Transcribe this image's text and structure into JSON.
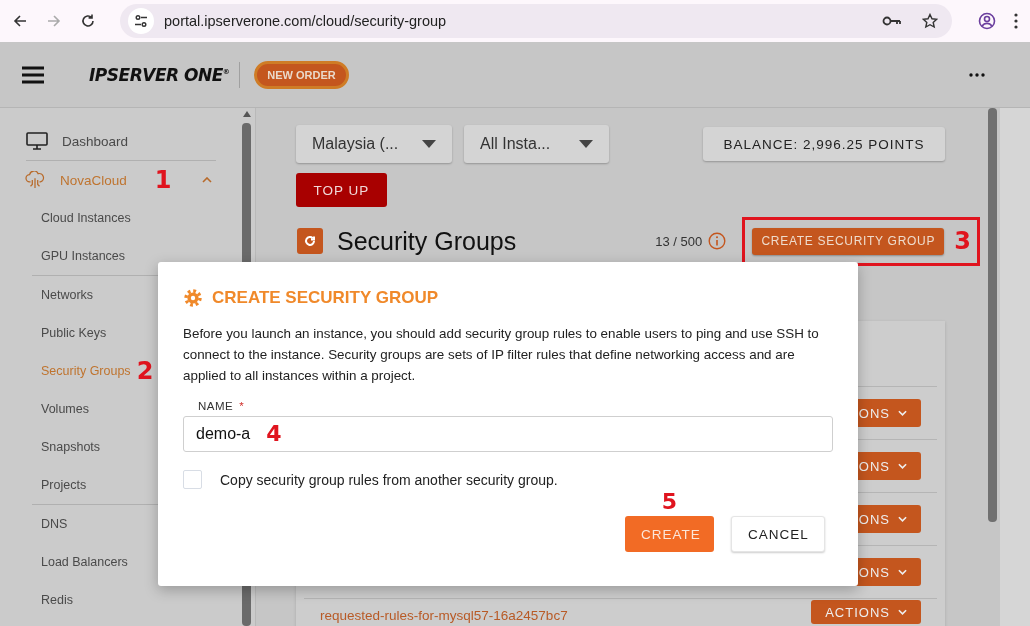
{
  "browser": {
    "url": "portal.ipserverone.com/cloud/security-group"
  },
  "header": {
    "logo": "IPSERVER ONE",
    "logo_mark": "®",
    "new_order": "NEW ORDER"
  },
  "sidebar": {
    "items": [
      {
        "label": "Dashboard",
        "kind": "monitor",
        "selected": false
      },
      {
        "label": "NovaCloud",
        "kind": "cloud",
        "selected": true,
        "expanded": true,
        "step": "1",
        "children": [
          {
            "label": "Cloud Instances",
            "selected": false,
            "divider_before": false
          },
          {
            "label": "GPU Instances",
            "selected": false,
            "divider_before": false
          },
          {
            "label": "Networks",
            "selected": false,
            "divider_before": true
          },
          {
            "label": "Public Keys",
            "selected": false,
            "divider_before": false
          },
          {
            "label": "Security Groups",
            "selected": true,
            "divider_before": false,
            "step": "2"
          },
          {
            "label": "Volumes",
            "selected": false,
            "divider_before": false
          },
          {
            "label": "Snapshots",
            "selected": false,
            "divider_before": false
          },
          {
            "label": "Projects",
            "selected": false,
            "divider_before": false
          },
          {
            "label": "DNS",
            "selected": false,
            "divider_before": true
          },
          {
            "label": "Load Balancers",
            "selected": false,
            "divider_before": false
          },
          {
            "label": "Redis",
            "selected": false,
            "divider_before": false
          }
        ]
      }
    ]
  },
  "filters": [
    {
      "value": "Malaysia (..."
    },
    {
      "value": "All Insta..."
    }
  ],
  "balance": "BALANCE: 2,996.25 POINTS",
  "top_up": "TOP UP",
  "page_title": "Security Groups",
  "count": "13 / 500",
  "create_button": {
    "label": "CREATE SECURITY GROUP",
    "step": "3"
  },
  "rows": [
    {
      "action": "ONS"
    },
    {
      "action": "ONS"
    },
    {
      "action": "ONS"
    },
    {
      "action": "ONS"
    },
    {
      "name": "requested-rules-for-mysql57-16a2457bc7",
      "action": "ACTIONS"
    }
  ],
  "dialog": {
    "title": "CREATE SECURITY GROUP",
    "description": "Before you launch an instance, you should add security group rules to enable users to ping and use SSH to connect to the instance. Security groups are sets of IP filter rules that define networking access and are applied to all instances within a project.",
    "field": {
      "label": "NAME",
      "required": true,
      "required_mark": "*",
      "value": "demo-a",
      "step": "4"
    },
    "checkbox": {
      "label": "Copy security group rules from another security group.",
      "checked": false
    },
    "buttons": [
      {
        "label": "CREATE",
        "kind": "primary",
        "step": "5"
      },
      {
        "label": "CANCEL",
        "kind": "secondary"
      }
    ]
  }
}
